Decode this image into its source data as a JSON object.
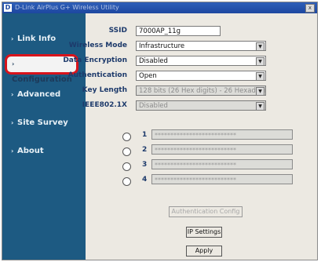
{
  "window": {
    "logo": "D",
    "title": "D-Link AirPlus G+ Wireless Utility",
    "close": "x"
  },
  "sidebar": {
    "items": [
      {
        "label": "Link Info",
        "active": false
      },
      {
        "label": "Configuration",
        "active": true
      },
      {
        "label": "Advanced",
        "active": false
      },
      {
        "label": "Site Survey",
        "active": false
      },
      {
        "label": "About",
        "active": false
      }
    ]
  },
  "config": {
    "ssid": {
      "label": "SSID",
      "value": "7000AP_11g"
    },
    "wireless_mode": {
      "label": "Wireless Mode",
      "value": "Infrastructure"
    },
    "data_encryption": {
      "label": "Data Encryption",
      "value": "Disabled"
    },
    "authentication": {
      "label": "Authentication",
      "value": "Open"
    },
    "key_length": {
      "label": "Key Length",
      "value": "128 bits (26 Hex digits) - 26 Hexadecimal"
    },
    "ieee8021x": {
      "label": "IEEE802.1X",
      "value": "Disabled"
    },
    "keys": [
      {
        "num": "1",
        "value": "**************************"
      },
      {
        "num": "2",
        "value": "**************************"
      },
      {
        "num": "3",
        "value": "**************************"
      },
      {
        "num": "4",
        "value": "**************************"
      }
    ],
    "auth_config_button": "Authentication Config",
    "ip_settings_button": "IP Settings",
    "apply_button": "Apply"
  },
  "colors": {
    "sidebar": "#1d5a82",
    "highlight": "#d8141c",
    "label": "#1d3a6b"
  }
}
